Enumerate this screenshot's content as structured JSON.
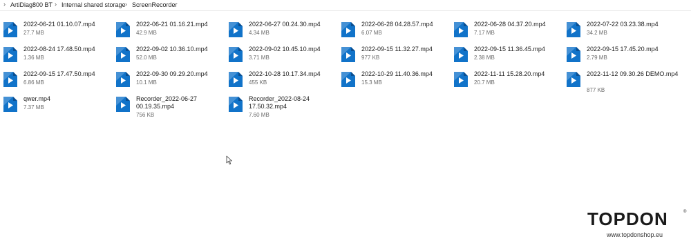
{
  "breadcrumb": {
    "items": [
      "ArtiDiag800 BT",
      "Internal shared storage",
      "ScreenRecorder"
    ],
    "separator": "›"
  },
  "files": [
    {
      "name": "2022-06-21 01.10.07.mp4",
      "size": "27.7 MB"
    },
    {
      "name": "2022-06-21 01.16.21.mp4",
      "size": "42.9 MB"
    },
    {
      "name": "2022-06-27 00.24.30.mp4",
      "size": "4.34 MB"
    },
    {
      "name": "2022-06-28 04.28.57.mp4",
      "size": "6.07 MB"
    },
    {
      "name": "2022-06-28 04.37.20.mp4",
      "size": "7.17 MB"
    },
    {
      "name": "2022-07-22 03.23.38.mp4",
      "size": "34.2 MB"
    },
    {
      "name": "2022-08-24 17.48.50.mp4",
      "size": "1.36 MB"
    },
    {
      "name": "2022-09-02 10.36.10.mp4",
      "size": "52.0 MB"
    },
    {
      "name": "2022-09-02 10.45.10.mp4",
      "size": "3.71 MB"
    },
    {
      "name": "2022-09-15 11.32.27.mp4",
      "size": "977 KB"
    },
    {
      "name": "2022-09-15 11.36.45.mp4",
      "size": "2.38 MB"
    },
    {
      "name": "2022-09-15 17.45.20.mp4",
      "size": "2.79 MB"
    },
    {
      "name": "2022-09-15 17.47.50.mp4",
      "size": "6.86 MB"
    },
    {
      "name": "2022-09-30 09.29.20.mp4",
      "size": "10.1 MB"
    },
    {
      "name": "2022-10-28 10.17.34.mp4",
      "size": "455 KB"
    },
    {
      "name": "2022-10-29 11.40.36.mp4",
      "size": "15.3 MB"
    },
    {
      "name": "2022-11-11 15.28.20.mp4",
      "size": "20.7 MB"
    },
    {
      "name": "2022-11-12 09.30.26 DEMO.mp4",
      "size": "877 KB"
    },
    {
      "name": "qwer.mp4",
      "size": "7.37 MB"
    },
    {
      "name": "Recorder_2022-06-27 00.19.35.mp4",
      "size": "756 KB"
    },
    {
      "name": "Recorder_2022-08-24 17.50.32.mp4",
      "size": "7.60 MB"
    }
  ],
  "file_icon": "video-file-icon",
  "colors": {
    "icon_blue": "#1173c9",
    "icon_dark": "#0a4f92",
    "accent": "#0078d4"
  },
  "branding": {
    "logo": "TOPDON",
    "registered": "®",
    "url": "www.topdonshop.eu"
  }
}
